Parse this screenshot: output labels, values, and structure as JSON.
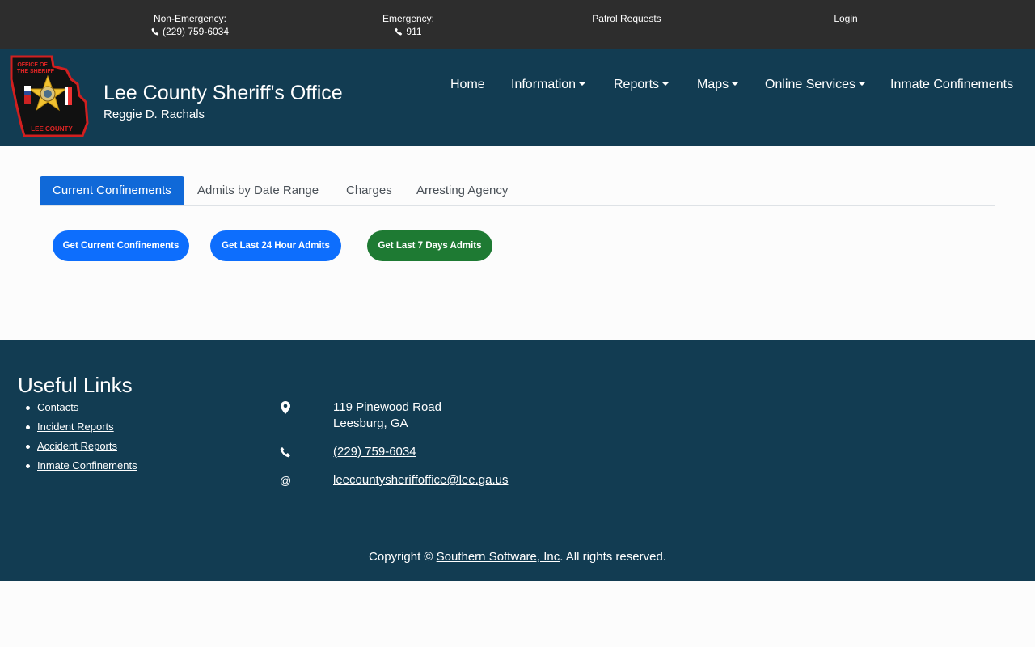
{
  "topbar": {
    "non_emergency_label": "Non-Emergency:",
    "non_emergency_phone": "(229) 759-6034",
    "emergency_label": "Emergency:",
    "emergency_phone": "911",
    "patrol_requests": "Patrol Requests",
    "login": "Login"
  },
  "header": {
    "title": "Lee County Sheriff's Office",
    "subtitle": "Reggie D. Rachals",
    "logo": {
      "top_text": "OFFICE OF THE SHERIFF",
      "bottom_text": "LEE COUNTY",
      "star_text": "SHERIFF",
      "colors": {
        "border": "#d21f1f",
        "fill": "#111111",
        "star": "#f2c230"
      }
    }
  },
  "nav": {
    "home": "Home",
    "information": "Information",
    "reports": "Reports",
    "maps": "Maps",
    "online_services": "Online Services",
    "inmate_confinements": "Inmate Confinements"
  },
  "tabs": {
    "current_confinements": "Current Confinements",
    "admits_by_date_range": "Admits by Date Range",
    "charges": "Charges",
    "arresting_agency": "Arresting Agency",
    "active": "Current Confinements"
  },
  "actions": {
    "get_current": "Get Current Confinements",
    "get_24h": "Get Last 24 Hour Admits",
    "get_7d": "Get Last 7 Days Admits"
  },
  "footer": {
    "heading": "Useful Links",
    "links": [
      "Contacts",
      "Incident Reports",
      "Accident Reports",
      "Inmate Confinements"
    ],
    "address_line1": "119 Pinewood Road",
    "address_line2": "Leesburg, GA",
    "phone": "(229) 759-6034",
    "email_symbol": "@",
    "email": "leecountysheriffoffice@lee.ga.us",
    "copyright_prefix": "Copyright ©",
    "company": "Southern Software, Inc",
    "copyright_suffix": ". All rights reserved."
  },
  "colors": {
    "topbar": "#2d2d2d",
    "header": "#123c52",
    "tab_active": "#1069d8",
    "button_blue": "#0d6efd",
    "button_green": "#1e7a33"
  }
}
